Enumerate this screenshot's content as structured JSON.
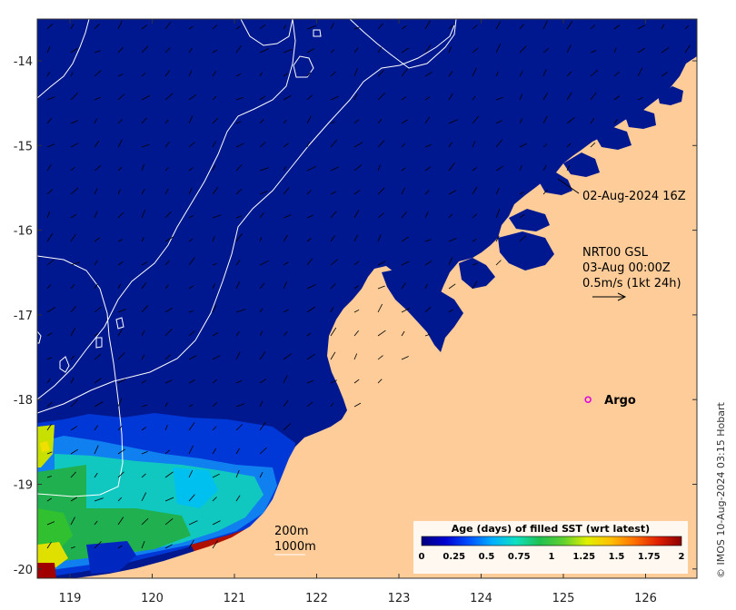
{
  "map": {
    "colors": {
      "ocean": "#00188f",
      "land": "#fdcc99",
      "contour": "#ffffff",
      "argo": "#e000e0",
      "arrow": "#000000"
    },
    "x_ticks": [
      {
        "value": 119,
        "label": "119"
      },
      {
        "value": 120,
        "label": "120"
      },
      {
        "value": 121,
        "label": "121"
      },
      {
        "value": 122,
        "label": "122"
      },
      {
        "value": 123,
        "label": "123"
      },
      {
        "value": 124,
        "label": "124"
      },
      {
        "value": 125,
        "label": "125"
      },
      {
        "value": 126,
        "label": "126"
      }
    ],
    "y_ticks": [
      {
        "value": -14,
        "label": "-14"
      },
      {
        "value": -15,
        "label": "-15"
      },
      {
        "value": -16,
        "label": "-16"
      },
      {
        "value": -17,
        "label": "-17"
      },
      {
        "value": -18,
        "label": "-18"
      },
      {
        "value": -19,
        "label": "-19"
      },
      {
        "value": -20,
        "label": "-20"
      }
    ],
    "annotations": {
      "date_label": "02-Aug-2024 16Z",
      "current_source": "NRT00 GSL",
      "current_time": "03-Aug 00:00Z",
      "scale_text": "0.5m/s (1kt 24h)",
      "argo_label": "Argo",
      "depth_200": "200m",
      "depth_1000": "1000m"
    },
    "argo_float": {
      "lon": 125.3,
      "lat": -18.0
    },
    "colorbar": {
      "title": "Age (days) of filled SST (wrt latest)",
      "ticks": [
        "0",
        "0.25",
        "0.5",
        "0.75",
        "1",
        "1.25",
        "1.5",
        "1.75",
        "2"
      ],
      "stops": [
        "#00007f",
        "#0000d0",
        "#0050ff",
        "#00b0ff",
        "#10e0c0",
        "#20c050",
        "#60d030",
        "#e0f000",
        "#ffc000",
        "#ff7000",
        "#e02000",
        "#8b0000"
      ]
    },
    "credit": "© IMOS 10-Aug-2024 03:15 Hobart"
  }
}
